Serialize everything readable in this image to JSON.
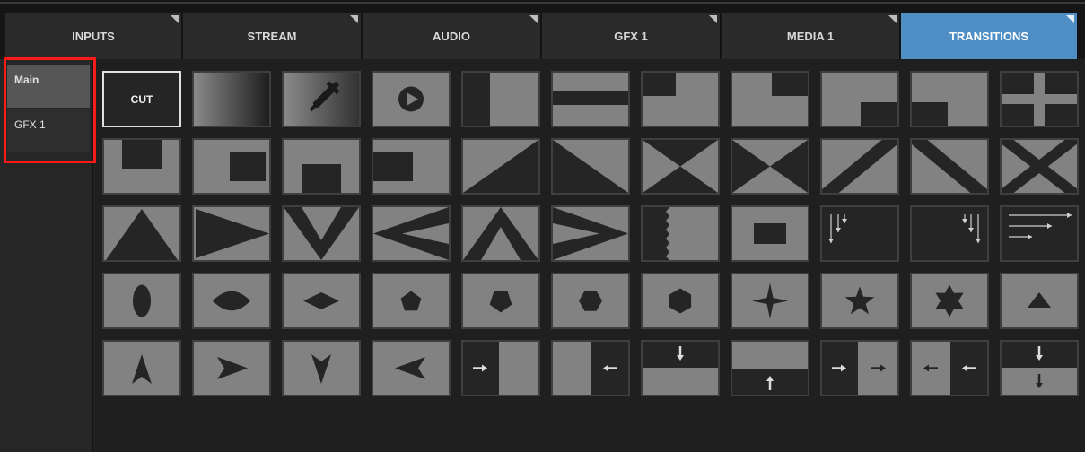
{
  "tabs": [
    {
      "label": "INPUTS",
      "active": false
    },
    {
      "label": "STREAM",
      "active": false
    },
    {
      "label": "AUDIO",
      "active": false
    },
    {
      "label": "GFX 1",
      "active": false
    },
    {
      "label": "MEDIA 1",
      "active": false
    },
    {
      "label": "TRANSITIONS",
      "active": true
    }
  ],
  "sidebar": {
    "items": [
      {
        "label": "Main",
        "selected": true
      },
      {
        "label": "GFX 1",
        "selected": false
      }
    ]
  },
  "transitions": {
    "cut_label": "CUT",
    "rows": [
      [
        "cut",
        "fade",
        "color-dip",
        "stinger",
        "wipe-left-edge",
        "wipe-top-bar",
        "box-top-left",
        "box-top-right",
        "box-bottom-right",
        "box-bottom-left",
        "quad-split"
      ],
      [
        "box-tl-corner",
        "box-center-right",
        "box-bottom-center",
        "box-left-center",
        "diagonal-up",
        "diagonal-down",
        "hourglass-vertical",
        "hourglass-horizontal",
        "diagonal-band-up",
        "diagonal-band-down",
        "x-cross"
      ],
      [
        "triangle-up",
        "triangle-right",
        "chevron-down",
        "chevron-left",
        "chevron-up",
        "chevron-right",
        "zigzag-wipe",
        "rect-center",
        "arrows-down-left",
        "arrows-down-right",
        "arrows-right-lines"
      ],
      [
        "ellipse-vertical",
        "eye-shape",
        "diamond",
        "pentagon",
        "pentagon-rotated",
        "hexagon",
        "hexagon-vertical",
        "star-4",
        "star-5",
        "star-6",
        "triangle-small"
      ],
      [
        "arrow-up",
        "arrow-right",
        "arrow-down",
        "arrow-left",
        "push-right",
        "push-left",
        "push-down",
        "push-up",
        "slide-right",
        "slide-left",
        "slide-down"
      ]
    ]
  },
  "colors": {
    "accent": "#4f8ec4",
    "highlight": "#ff1a1a",
    "tile": "#828282",
    "shape": "#252525"
  }
}
